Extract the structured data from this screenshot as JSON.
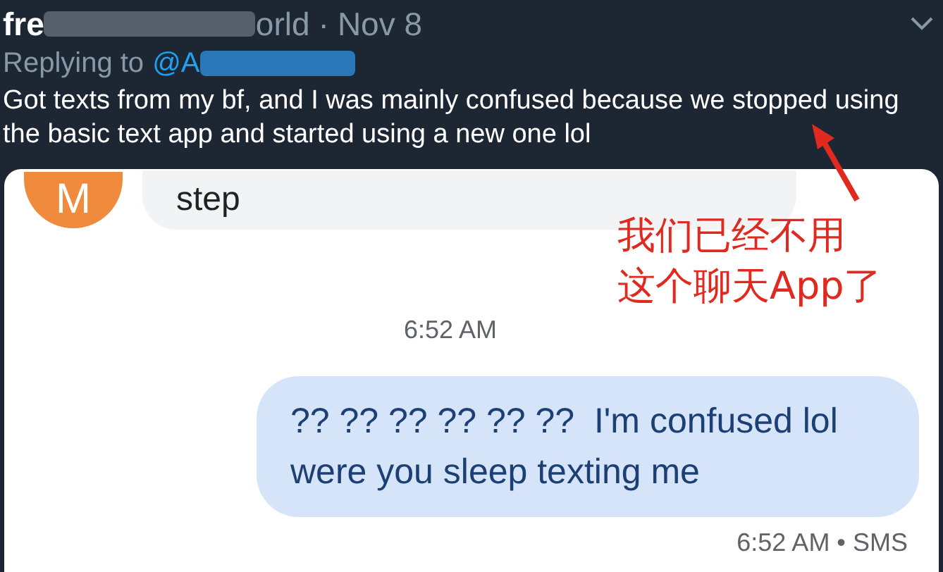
{
  "tweet": {
    "author_start": "fre",
    "author_end": "orld",
    "separator": "·",
    "date": "Nov 8",
    "replying_label": "Replying to",
    "replying_handle": "@A",
    "text": "Got texts from my bf, and I was mainly confused because we stopped using the basic text app and started using a new one lol"
  },
  "chat": {
    "incoming": {
      "avatar_letter": "M",
      "text": "step"
    },
    "timestamp": "6:52 AM",
    "outgoing": {
      "text": "?? ?? ?? ?? ?? ??  I'm confused lol were you sleep texting me",
      "meta": "6:52 AM • SMS"
    }
  },
  "annotation": {
    "lines": [
      "我们已经不用",
      "这个聊天App了"
    ]
  }
}
